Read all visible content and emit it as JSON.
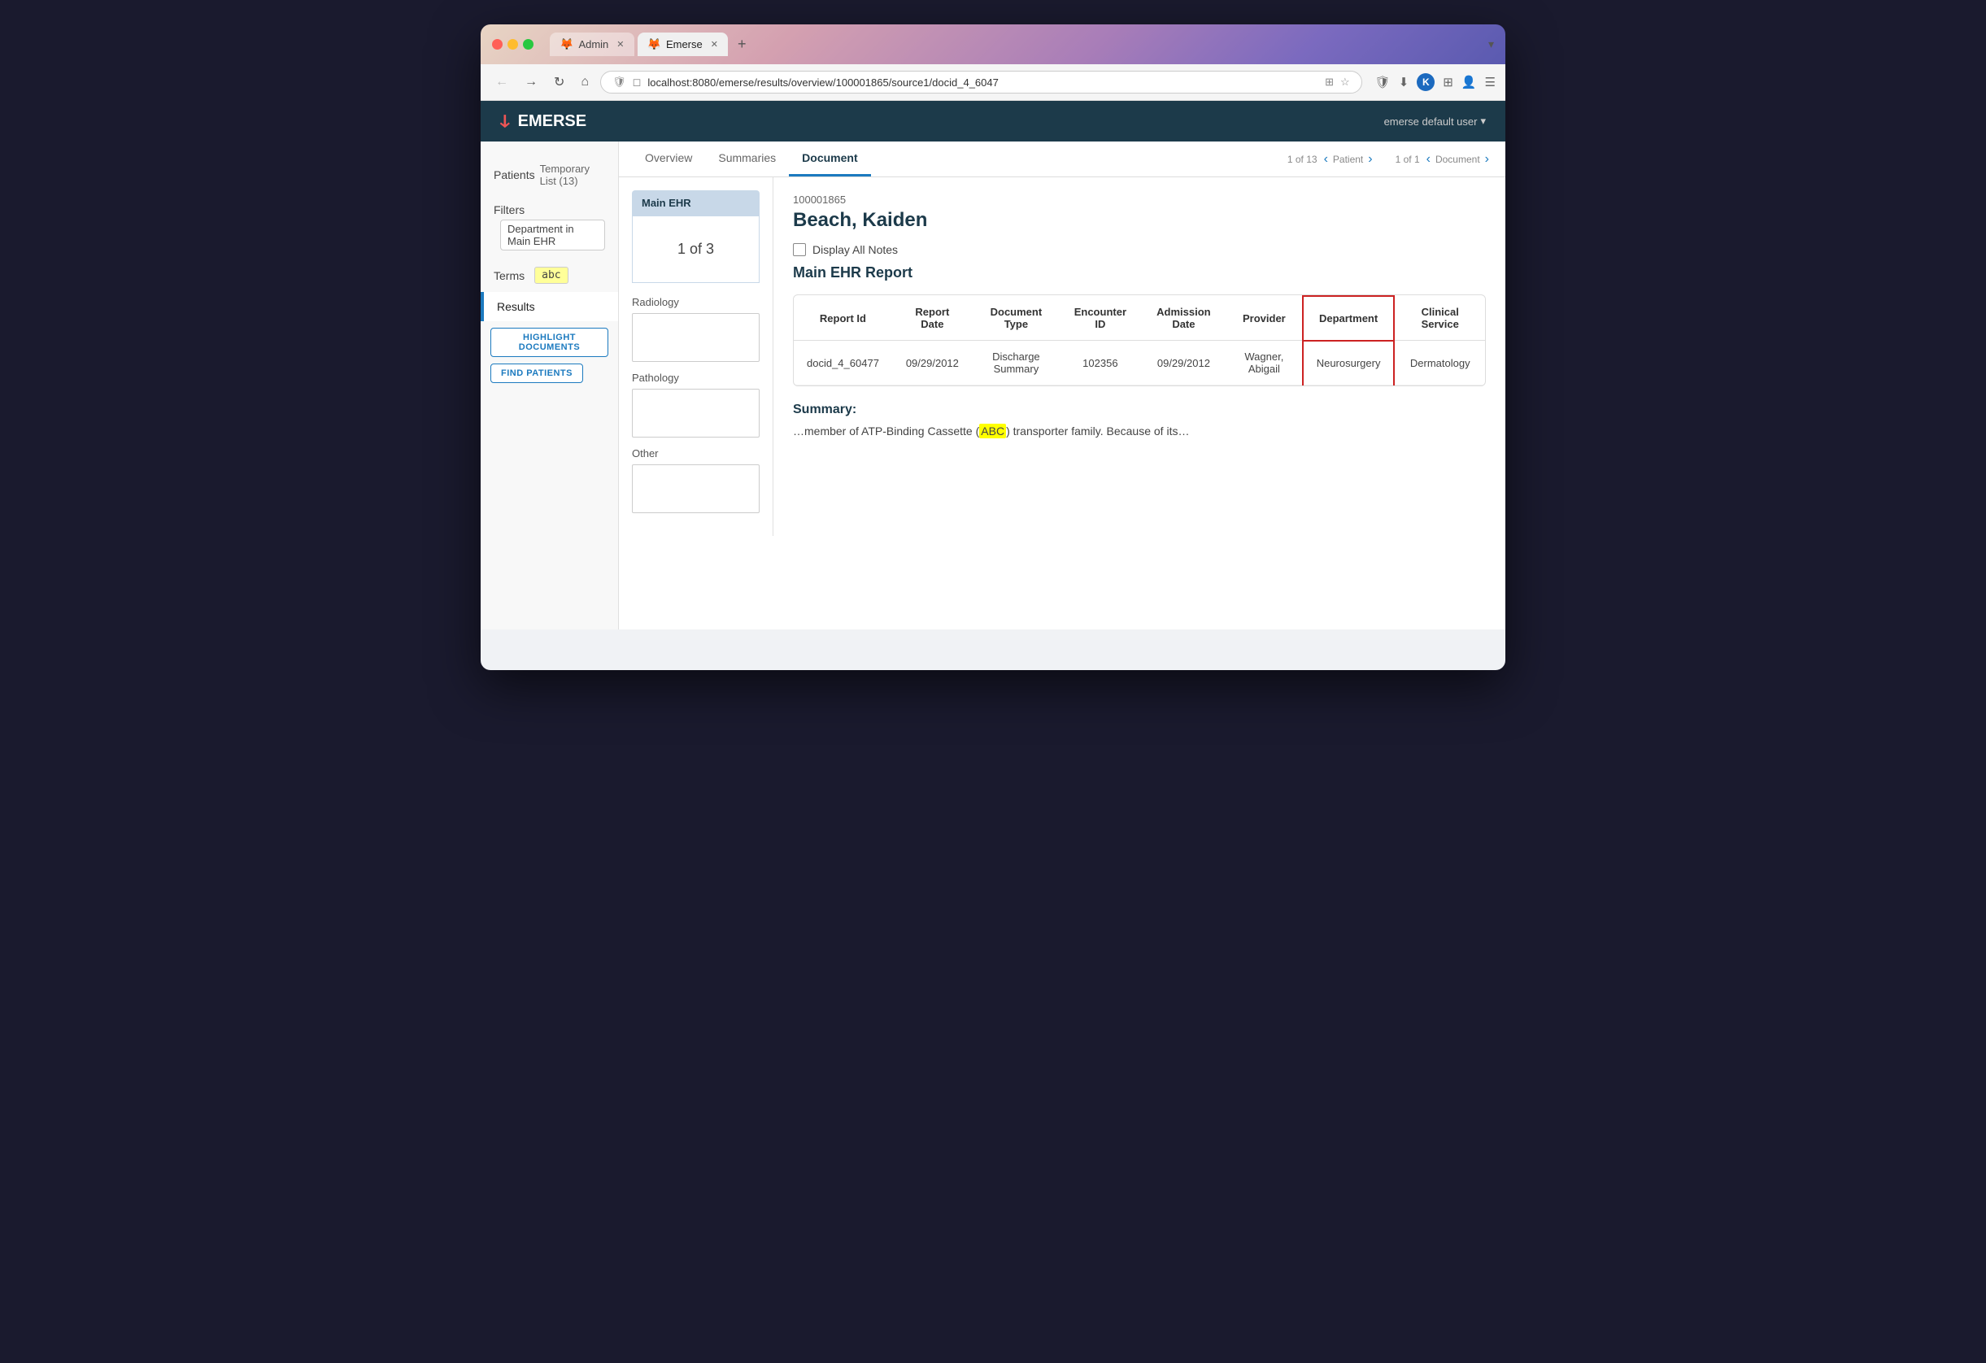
{
  "browser": {
    "tabs": [
      {
        "id": "admin",
        "label": "Admin",
        "active": false,
        "icon": "🦊"
      },
      {
        "id": "emerse",
        "label": "Emerse",
        "active": true,
        "icon": "🦊"
      }
    ],
    "address": "localhost:8080/emerse/results/overview/100001865/source1/docid_4_6047",
    "new_tab_label": "+"
  },
  "app": {
    "title": "EMERSE",
    "user": "emerse default user",
    "user_dropdown": "▾"
  },
  "sidebar": {
    "patients_label": "Patients",
    "patients_value": "Temporary List (13)",
    "filters_label": "Filters",
    "filters_value": "Department in Main EHR",
    "terms_label": "Terms",
    "terms_value": "abc",
    "results_label": "Results",
    "highlight_btn": "HIGHLIGHT DOCUMENTS",
    "find_btn": "FIND PATIENTS"
  },
  "tabs": {
    "overview": "Overview",
    "summaries": "Summaries",
    "document": "Document",
    "patient_nav": {
      "label": "Patient",
      "current": "1",
      "total": "13"
    },
    "document_nav": {
      "label": "Document",
      "current": "1",
      "total": "1"
    }
  },
  "source_panel": {
    "main_ehr_label": "Main EHR",
    "main_ehr_count": "1 of 3",
    "radiology_label": "Radiology",
    "pathology_label": "Pathology",
    "other_label": "Other"
  },
  "patient": {
    "id": "100001865",
    "name": "Beach, Kaiden",
    "display_all_notes": "Display All Notes",
    "report_title": "Main EHR Report"
  },
  "table": {
    "headers": [
      "Report Id",
      "Report Date",
      "Document Type",
      "Encounter ID",
      "Admission Date",
      "Provider",
      "Department",
      "Clinical Service"
    ],
    "rows": [
      {
        "report_id": "docid_4_60477",
        "report_date": "09/29/2012",
        "document_type": "Discharge Summary",
        "encounter_id": "102356",
        "admission_date": "09/29/2012",
        "provider": "Wagner, Abigail",
        "department": "Neurosurgery",
        "clinical_service": "Dermatology"
      }
    ]
  },
  "summary": {
    "title": "Summary:",
    "text_before": "…member of ATP-Binding Cassette (",
    "highlight": "ABC",
    "text_after": ") transporter family. Because of its…"
  }
}
